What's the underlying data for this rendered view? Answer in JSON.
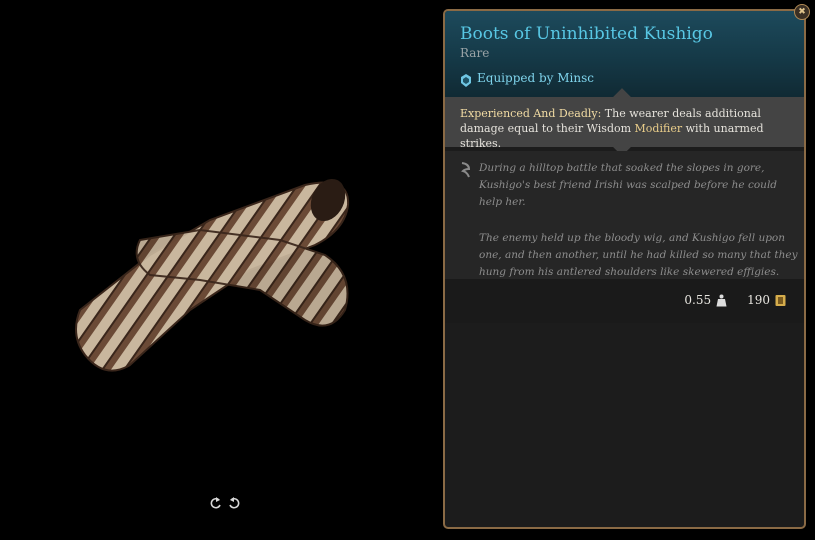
{
  "item": {
    "name": "Boots of Uninhibited Kushigo",
    "rarity": "Rare",
    "equipped_by": "Equipped by Minsc",
    "passive": {
      "name": "Experienced And Deadly:",
      "text_before": " The wearer deals additional damage equal to their Wisdom ",
      "highlight": "Modifier",
      "text_after": " with unarmed strikes."
    },
    "lore": [
      "During a hilltop battle that soaked the slopes in gore, Kushigo's best friend Irishi was scalped before he could help her.",
      "The enemy held up the bloody wig, and Kushigo fell upon one, and then another, until he had killed so many that they hung from his antlered shoulders like skewered effigies."
    ],
    "weight": "0.55",
    "value": "190"
  },
  "icons": {
    "equipped": "equipped-character-icon",
    "lore": "lore-quill-icon",
    "weight": "weight-icon",
    "value": "gold-coin-icon",
    "rotate_left": "rotate-left-icon",
    "rotate_right": "rotate-right-icon",
    "close": "close-icon"
  },
  "colors": {
    "title": "#58c7e4",
    "equipped": "#7fd4ec",
    "frame": "#8a6a45",
    "highlight": "#e9cd8a"
  }
}
